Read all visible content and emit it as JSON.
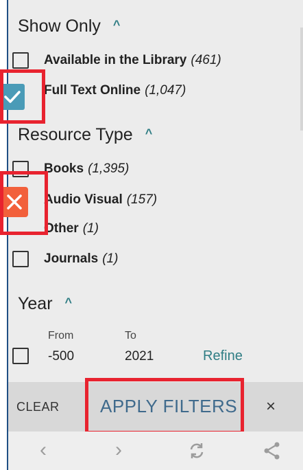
{
  "show_only": {
    "title": "Show Only",
    "items": [
      {
        "label": "Available in the Library",
        "count": "(461)"
      },
      {
        "label": "Full Text Online",
        "count": "(1,047)"
      }
    ]
  },
  "resource_type": {
    "title": "Resource Type",
    "items": [
      {
        "label": "Books",
        "count": "(1,395)"
      },
      {
        "label": "Audio Visual",
        "count": "(157)"
      },
      {
        "label": "Other",
        "count": "(1)"
      },
      {
        "label": "Journals",
        "count": "(1)"
      }
    ]
  },
  "year": {
    "title": "Year",
    "from_label": "From",
    "to_label": "To",
    "from_value": "-500",
    "to_value": "2021",
    "refine_label": "Refine"
  },
  "actions": {
    "clear_label": "CLEAR",
    "apply_label": "APPLY FILTERS",
    "close_label": "×"
  },
  "colors": {
    "accent": "#2f7d84",
    "highlight": "#e8232f",
    "checked": "#4a9bb7",
    "exclude": "#f2603b"
  }
}
